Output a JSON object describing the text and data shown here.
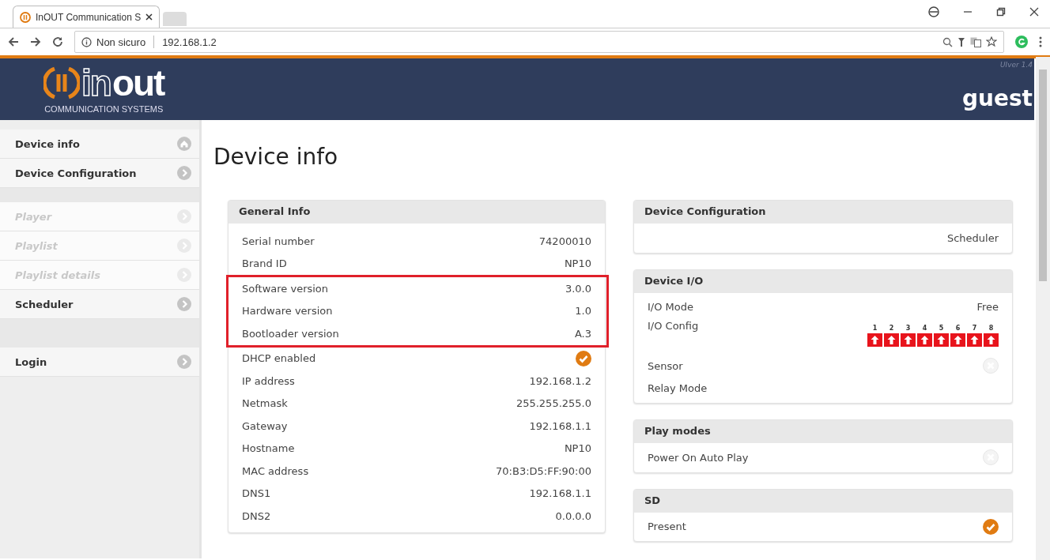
{
  "browser": {
    "tab": {
      "title": "InOUT Communication S"
    },
    "address": {
      "security": "Non sicuro",
      "url": "192.168.1.2"
    }
  },
  "header": {
    "logo": {
      "word_a": "in",
      "word_b": "out",
      "tagline": "COMMUNICATION SYSTEMS"
    },
    "version": "UIver 1.4",
    "user": "guest"
  },
  "sidebar": {
    "items": [
      {
        "kind": "home",
        "label": "Device info",
        "disabled": false
      },
      {
        "kind": "link",
        "label": "Device Configuration",
        "disabled": false
      },
      {
        "kind": "gap"
      },
      {
        "kind": "link",
        "label": "Player",
        "disabled": true
      },
      {
        "kind": "link",
        "label": "Playlist",
        "disabled": true
      },
      {
        "kind": "link",
        "label": "Playlist details",
        "disabled": true
      },
      {
        "kind": "link",
        "label": "Scheduler",
        "disabled": false
      },
      {
        "kind": "gap"
      },
      {
        "kind": "gap"
      },
      {
        "kind": "link",
        "label": "Login",
        "disabled": false
      }
    ]
  },
  "page": {
    "title": "Device info"
  },
  "general_info": {
    "title": "General Info",
    "rows": [
      {
        "kind": "text",
        "label": "Serial number",
        "value": "74200010",
        "highlighted": false
      },
      {
        "kind": "text",
        "label": "Brand ID",
        "value": "NP10",
        "highlighted": false
      },
      {
        "kind": "text",
        "label": "Software version",
        "value": "3.0.0",
        "highlighted": true
      },
      {
        "kind": "text",
        "label": "Hardware version",
        "value": "1.0",
        "highlighted": true
      },
      {
        "kind": "text",
        "label": "Bootloader version",
        "value": "A.3",
        "highlighted": true
      },
      {
        "kind": "toggle",
        "label": "DHCP enabled",
        "checked": true,
        "highlighted": false
      },
      {
        "kind": "text",
        "label": "IP address",
        "value": "192.168.1.2",
        "highlighted": false
      },
      {
        "kind": "text",
        "label": "Netmask",
        "value": "255.255.255.0",
        "highlighted": false
      },
      {
        "kind": "text",
        "label": "Gateway",
        "value": "192.168.1.1",
        "highlighted": false
      },
      {
        "kind": "text",
        "label": "Hostname",
        "value": "NP10",
        "highlighted": false
      },
      {
        "kind": "text",
        "label": "MAC address",
        "value": "70:B3:D5:FF:90:00",
        "highlighted": false
      },
      {
        "kind": "text",
        "label": "DNS1",
        "value": "192.168.1.1",
        "highlighted": false
      },
      {
        "kind": "text",
        "label": "DNS2",
        "value": "0.0.0.0",
        "highlighted": false
      }
    ]
  },
  "side_cards": [
    {
      "title": "Device Configuration",
      "rows": [
        {
          "kind": "text",
          "value": "Scheduler"
        }
      ]
    },
    {
      "title": "Device I/O",
      "rows": [
        {
          "kind": "text",
          "label": "I/O Mode",
          "value": "Free"
        },
        {
          "kind": "ports",
          "label": "I/O Config",
          "ports": [
            "1",
            "2",
            "3",
            "4",
            "5",
            "6",
            "7",
            "8"
          ]
        },
        {
          "kind": "toggle",
          "label": "Sensor",
          "checked": false
        },
        {
          "kind": "text",
          "label": "Relay Mode"
        }
      ]
    },
    {
      "title": "Play modes",
      "rows": [
        {
          "kind": "toggle",
          "label": "Power On Auto Play",
          "checked": false
        }
      ]
    },
    {
      "title": "SD",
      "rows": [
        {
          "kind": "toggle",
          "label": "Present",
          "checked": true
        }
      ]
    }
  ]
}
